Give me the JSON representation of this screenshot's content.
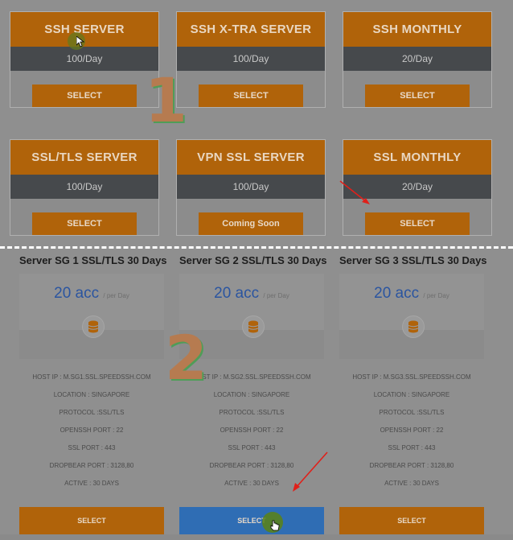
{
  "packages": [
    {
      "title": "SSH SERVER",
      "quota": "100/Day",
      "button": "SELECT"
    },
    {
      "title": "SSH X-TRA SERVER",
      "quota": "100/Day",
      "button": "SELECT"
    },
    {
      "title": "SSH MONTHLY",
      "quota": "20/Day",
      "button": "SELECT"
    },
    {
      "title": "SSL/TLS SERVER",
      "quota": "100/Day",
      "button": "SELECT"
    },
    {
      "title": "VPN SSL SERVER",
      "quota": "100/Day",
      "button": "Coming Soon"
    },
    {
      "title": "SSL MONTHLY",
      "quota": "20/Day",
      "button": "SELECT"
    }
  ],
  "annotations": {
    "step1": "1",
    "step2": "2",
    "arrow_color": "#e0201a"
  },
  "plans": [
    {
      "title": "Server SG 1 SSL/TLS 30 Days",
      "price": "20 acc",
      "per": "/ per Day",
      "specs": [
        "HOST IP : M.SG1.SSL.SPEEDSSH.COM",
        "LOCATION : SINGAPORE",
        "PROTOCOL :SSL/TLS",
        "OPENSSH PORT : 22",
        "SSL PORT : 443",
        "DROPBEAR PORT : 3128,80",
        "ACTIVE : 30 DAYS"
      ],
      "button": "SELECT"
    },
    {
      "title": "Server SG 2 SSL/TLS 30 Days",
      "price": "20 acc",
      "per": "/ per Day",
      "specs": [
        "HOST IP : M.SG2.SSL.SPEEDSSH.COM",
        "LOCATION : SINGAPORE",
        "PROTOCOL :SSL/TLS",
        "OPENSSH PORT : 22",
        "SSL PORT : 443",
        "DROPBEAR PORT : 3128,80",
        "ACTIVE : 30 DAYS"
      ],
      "button": "SELECT"
    },
    {
      "title": "Server SG 3 SSL/TLS 30 Days",
      "price": "20 acc",
      "per": "/ per Day",
      "specs": [
        "HOST IP : M.SG3.SSL.SPEEDSSH.COM",
        "LOCATION : SINGAPORE",
        "PROTOCOL :SSL/TLS",
        "OPENSSH PORT : 22",
        "SSL PORT : 443",
        "DROPBEAR PORT : 3128,80",
        "ACTIVE : 30 DAYS"
      ],
      "button": "SELECT"
    }
  ],
  "colors": {
    "accent": "#b0630a",
    "band": "#46494c",
    "selected": "#2f6db4",
    "price": "#2b55a0"
  }
}
